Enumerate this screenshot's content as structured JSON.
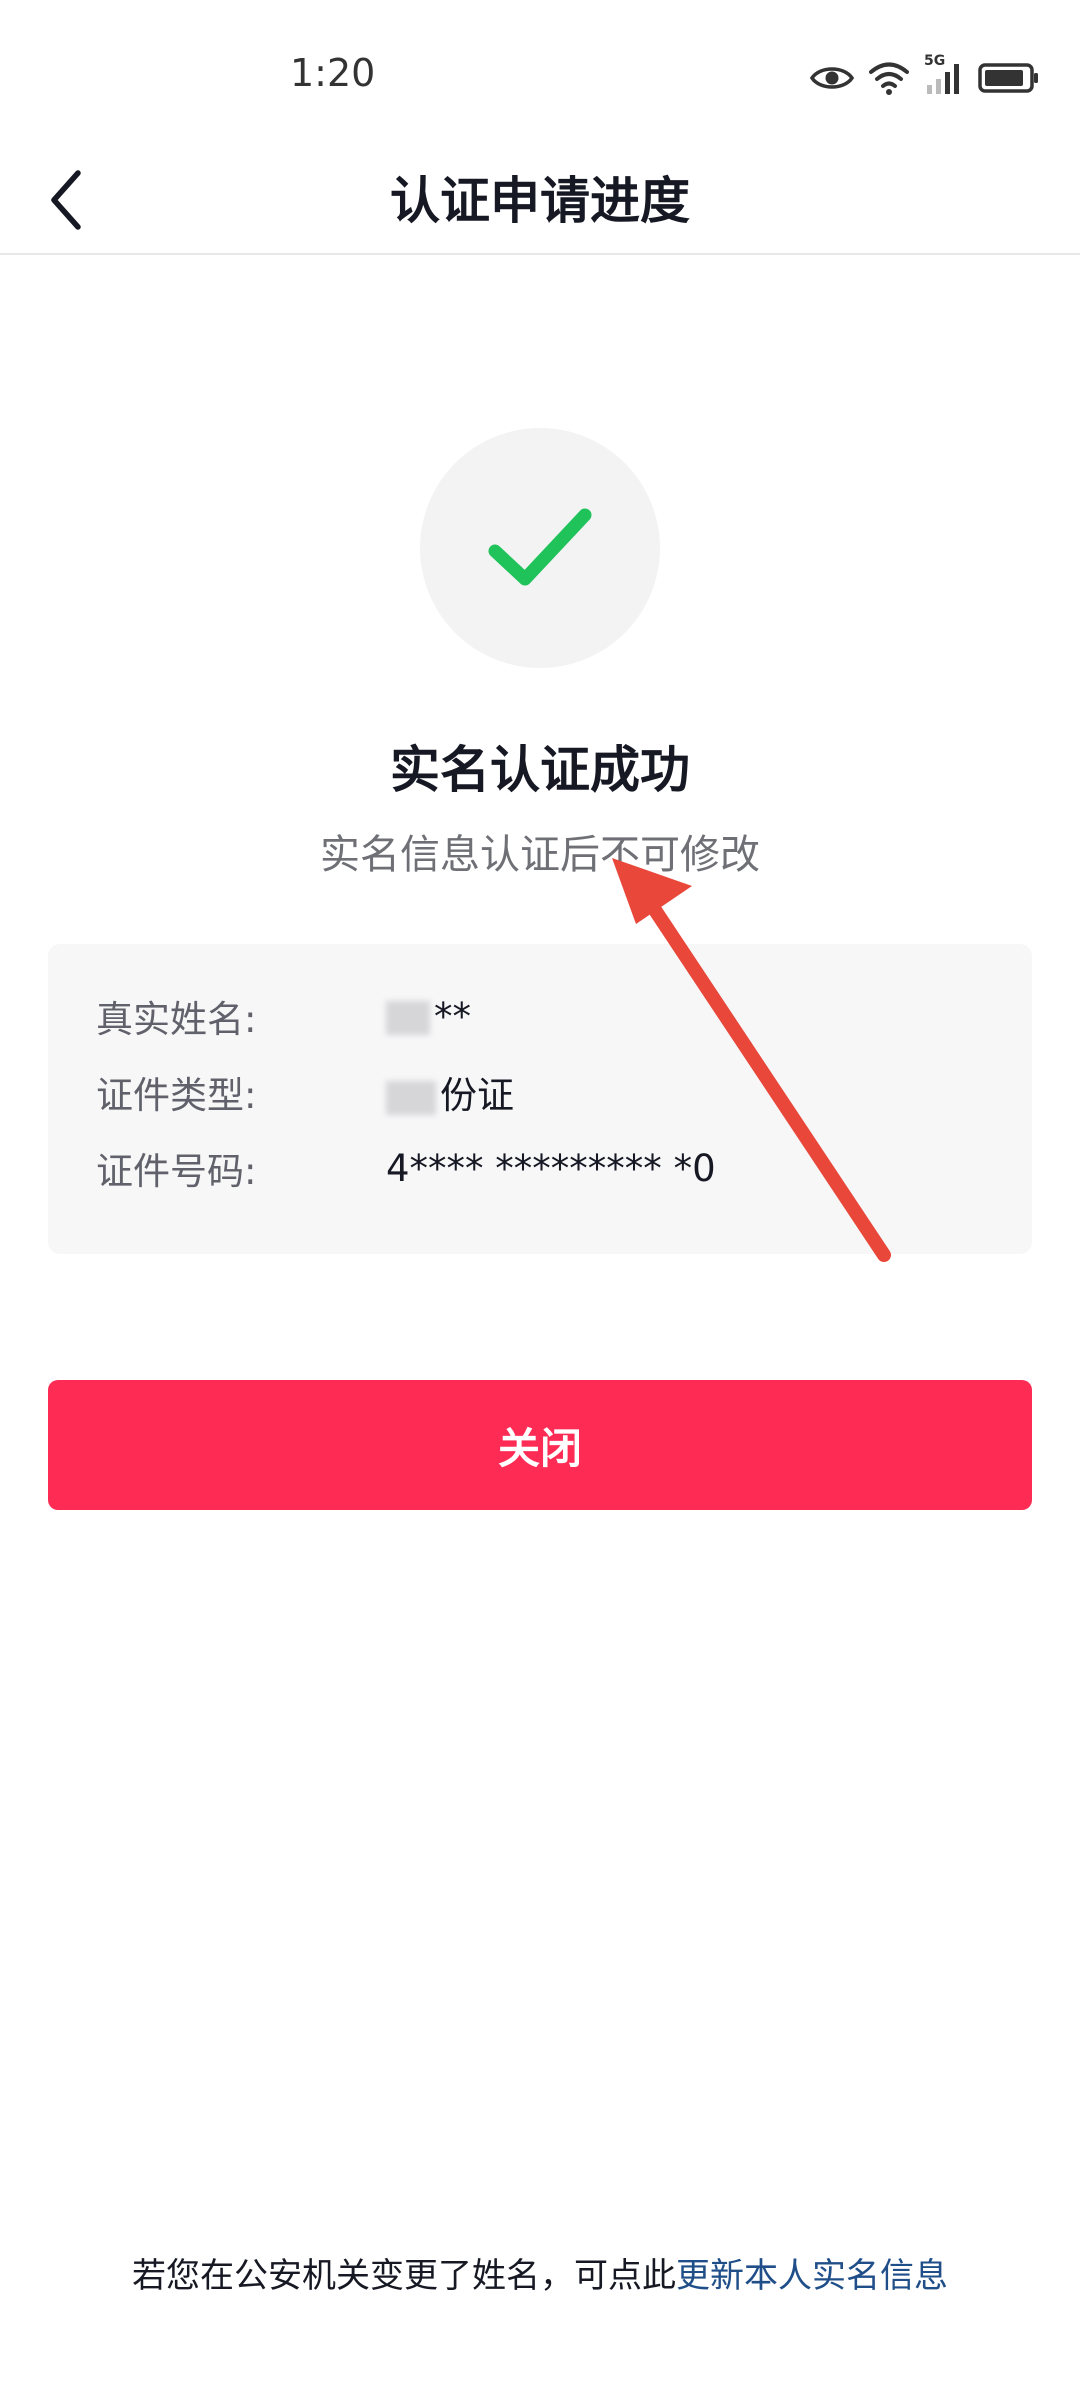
{
  "status_bar": {
    "time": "1:20",
    "network_label": "5G",
    "icons": [
      "eye-icon",
      "wifi-icon",
      "cellular-signal-icon",
      "battery-icon"
    ]
  },
  "nav": {
    "title": "认证申请进度",
    "back_icon": "chevron-left-icon"
  },
  "result": {
    "icon": "checkmark-icon",
    "title": "实名认证成功",
    "note": "实名信息认证后不可修改"
  },
  "info": {
    "rows": [
      {
        "label": "真实姓名:",
        "value": "**"
      },
      {
        "label": "证件类型:",
        "value": "份证"
      },
      {
        "label": "证件号码:",
        "value": "4**** ********* *0"
      }
    ]
  },
  "actions": {
    "close_label": "关闭"
  },
  "footer": {
    "prefix": "若您在公安机关变更了姓名，可点此",
    "link": "更新本人实名信息"
  },
  "colors": {
    "accent": "#fe2c55",
    "success_green": "#20c25a",
    "link": "#1f4e89",
    "annotation": "#e8473a"
  }
}
